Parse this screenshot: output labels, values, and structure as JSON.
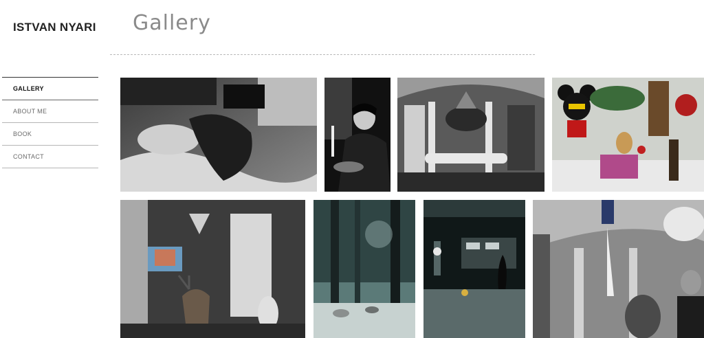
{
  "header": {
    "site_name": "ISTVAN NYARI",
    "page_title": "Gallery"
  },
  "nav": {
    "items": [
      {
        "label": "GALLERY",
        "active": true
      },
      {
        "label": "ABOUT ME",
        "active": false
      },
      {
        "label": "BOOK",
        "active": false
      },
      {
        "label": "CONTACT",
        "active": false
      }
    ]
  },
  "colors": {
    "text_dark": "#222222",
    "title_gray": "#8a8a8a",
    "nav_gray": "#6a6a6a",
    "rule": "#b8b8b8"
  }
}
